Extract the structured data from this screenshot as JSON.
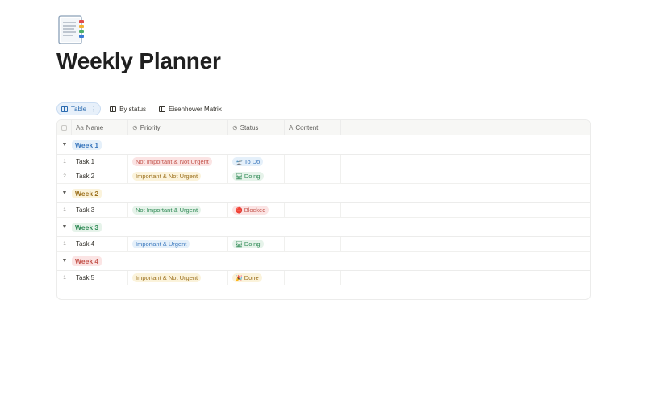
{
  "page": {
    "icon": "document-icon",
    "title": "Weekly Planner"
  },
  "views": [
    {
      "label": "Table",
      "icon": "table-icon",
      "active": true
    },
    {
      "label": "By status",
      "icon": "board-icon",
      "active": false
    },
    {
      "label": "Eisenhower Matrix",
      "icon": "board-icon",
      "active": false
    }
  ],
  "columns": {
    "name": "Name",
    "priority": "Priority",
    "status": "Status",
    "content": "Content"
  },
  "groups": [
    {
      "label": "Week 1",
      "color": "#3a77bd",
      "bg": "#e5f0fa",
      "rows": [
        {
          "num": "1",
          "name": "Task 1",
          "priority": "Not Important & Not Urgent",
          "priority_style": "niu",
          "status": "To Do",
          "status_style": "todo",
          "status_icon": "🛫"
        },
        {
          "num": "2",
          "name": "Task 2",
          "priority": "Important & Not Urgent",
          "priority_style": "inu",
          "status": "Doing",
          "status_style": "doing",
          "status_icon": "🛤"
        }
      ]
    },
    {
      "label": "Week 2",
      "color": "#9a6e1a",
      "bg": "#fbf3db",
      "rows": [
        {
          "num": "1",
          "name": "Task 3",
          "priority": "Not Important & Urgent",
          "priority_style": "niu-g",
          "status": "Blocked",
          "status_style": "blocked",
          "status_icon": "⛔"
        }
      ]
    },
    {
      "label": "Week 3",
      "color": "#2f8a55",
      "bg": "#e6f3ea",
      "rows": [
        {
          "num": "1",
          "name": "Task 4",
          "priority": "Important & Urgent",
          "priority_style": "iu",
          "status": "Doing",
          "status_style": "doing",
          "status_icon": "🛤"
        }
      ]
    },
    {
      "label": "Week 4",
      "color": "#c4554d",
      "bg": "#fbe4e4",
      "rows": [
        {
          "num": "1",
          "name": "Task 5",
          "priority": "Important & Not Urgent",
          "priority_style": "inu",
          "status": "Done",
          "status_style": "done",
          "status_icon": "🎉"
        }
      ]
    }
  ]
}
